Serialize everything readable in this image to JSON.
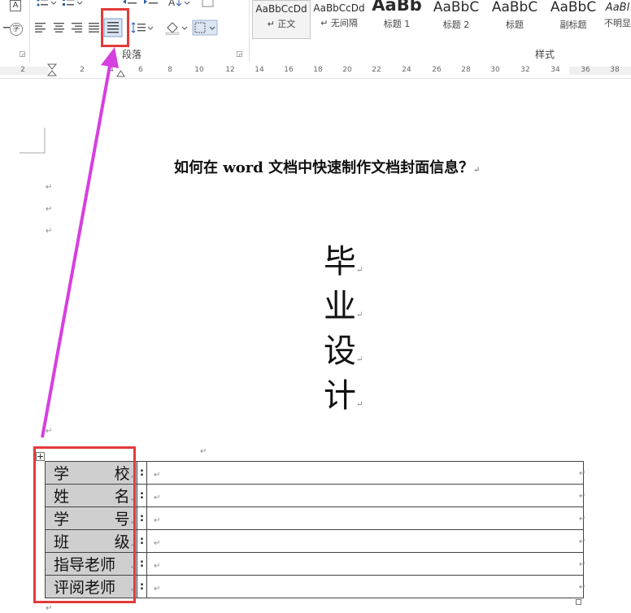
{
  "ribbon": {
    "paragraph_group_label": "段落",
    "styles_group_label": "样式",
    "shading_char": "字",
    "styles": [
      {
        "preview": "AaBbCcDd",
        "name": "↵ 正文"
      },
      {
        "preview": "AaBbCcDd",
        "name": "↵ 无间隔"
      },
      {
        "preview": "AaBb",
        "name": "标题 1"
      },
      {
        "preview": "AaBbC",
        "name": "标题 2"
      },
      {
        "preview": "AaBbC",
        "name": "标题"
      },
      {
        "preview": "AaBbC",
        "name": "副标题"
      },
      {
        "preview": "AaBl",
        "name": "不明显"
      }
    ]
  },
  "ruler": {
    "ticks": [
      "2",
      "2",
      "4",
      "6",
      "8",
      "10",
      "12",
      "14",
      "16",
      "18",
      "20",
      "22",
      "24",
      "26",
      "28",
      "30",
      "32",
      "34",
      "36",
      "38"
    ]
  },
  "document": {
    "title": "如何在 word 文档中快速制作文档封面信息？",
    "paragraph_mark": "↵",
    "vertical_title": [
      "毕",
      "业",
      "设",
      "计"
    ],
    "table": {
      "colon": ":",
      "rows": [
        {
          "label_left": "学",
          "label_right": "校"
        },
        {
          "label_left": "姓",
          "label_right": "名"
        },
        {
          "label_left": "学",
          "label_right": "号"
        },
        {
          "label_left": "班",
          "label_right": "级"
        },
        {
          "label_left": "指导老师",
          "label_right": ""
        },
        {
          "label_left": "评阅老师",
          "label_right": ""
        }
      ]
    }
  },
  "annotation": {
    "highlight_color": "#e23b3b",
    "arrow_color": "#d63fe0"
  }
}
